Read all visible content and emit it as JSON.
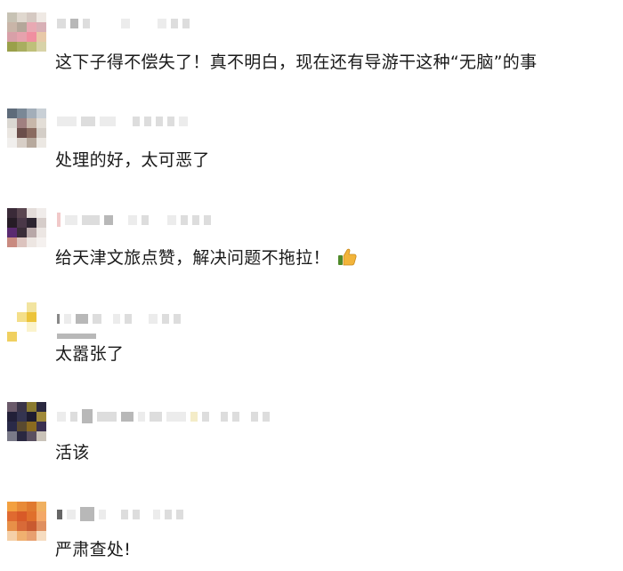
{
  "comments": [
    {
      "text": "这下子得不偿失了！真不明白，现在还有导游干这种“无脑”的事",
      "has_emoji": false,
      "avatar_color": "#e8a9a9",
      "avatar_accent": "#9aa04a"
    },
    {
      "text": "处理的好，太可恶了",
      "has_emoji": false,
      "avatar_color": "#8a9aa8",
      "avatar_accent": "#6b4e4a"
    },
    {
      "text": "给天津文旅点赞，解决问题不拖拉！",
      "has_emoji": true,
      "emoji_icon": "thumbs-up-icon",
      "avatar_color": "#3a2a38",
      "avatar_accent": "#c98a80"
    },
    {
      "text": "太嚣张了",
      "has_emoji": false,
      "avatar_color": "#f0d060",
      "avatar_accent": "#ffffff"
    },
    {
      "text": "活该",
      "has_emoji": false,
      "avatar_color": "#2a2840",
      "avatar_accent": "#8a7a30"
    },
    {
      "text": "严肃查处!",
      "has_emoji": false,
      "avatar_color": "#e06a30",
      "avatar_accent": "#f3a040"
    }
  ]
}
